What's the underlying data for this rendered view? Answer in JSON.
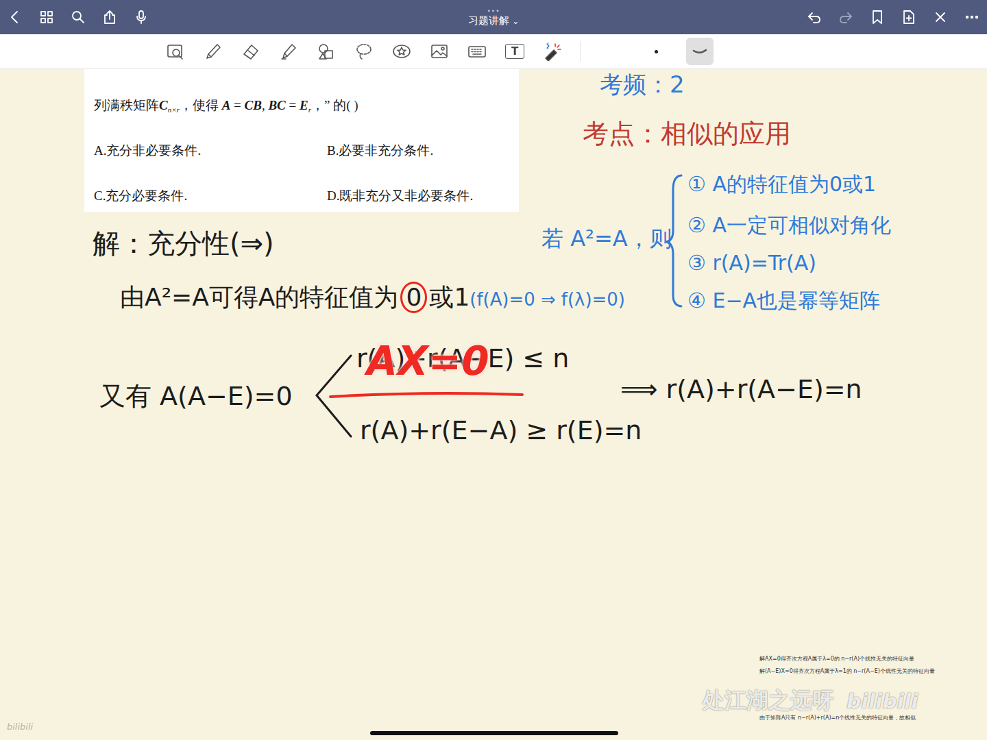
{
  "top_bar": {
    "handle": "•••",
    "title": "习题讲解",
    "title_caret": "⌄"
  },
  "toolbar": {
    "tools": [
      {
        "kind": "zoom",
        "glyph": "",
        "selected": false
      },
      {
        "kind": "pen",
        "glyph": "",
        "selected": false
      },
      {
        "kind": "eraser",
        "glyph": "",
        "selected": false
      },
      {
        "kind": "highlighter",
        "glyph": "",
        "selected": false
      },
      {
        "kind": "shapes",
        "glyph": "",
        "selected": false
      },
      {
        "kind": "lasso",
        "glyph": "",
        "selected": false
      },
      {
        "kind": "sticker",
        "glyph": "",
        "selected": false
      },
      {
        "kind": "image",
        "glyph": "",
        "selected": false
      },
      {
        "kind": "keyboard",
        "glyph": "",
        "selected": false
      },
      {
        "kind": "text",
        "glyph": "T",
        "selected": false
      },
      {
        "kind": "laser",
        "glyph": "",
        "selected": false
      }
    ],
    "pen_options": [
      {
        "kind": "dot",
        "selected": false
      },
      {
        "kind": "curve",
        "selected": true
      }
    ]
  },
  "problem": {
    "stem": [
      {
        "kind": "text",
        "text": "列满秩矩阵"
      },
      {
        "kind": "math",
        "text": "C"
      },
      {
        "kind": "sub",
        "text": "n×r"
      },
      {
        "kind": "text",
        "text": "，使得 "
      },
      {
        "kind": "math",
        "text": "A"
      },
      {
        "kind": "text",
        "text": " = "
      },
      {
        "kind": "math",
        "text": "CB"
      },
      {
        "kind": "text",
        "text": ", "
      },
      {
        "kind": "math",
        "text": "BC"
      },
      {
        "kind": "text",
        "text": " = "
      },
      {
        "kind": "math",
        "text": "E"
      },
      {
        "kind": "sub",
        "text": "r"
      },
      {
        "kind": "text",
        "text": "，” 的(      )"
      }
    ],
    "options": [
      "A.充分非必要条件.",
      "B.必要非充分条件.",
      "C.充分必要条件.",
      "D.既非充分又非必要条件."
    ]
  },
  "notes": [
    {
      "parts": [
        {
          "text": "考频：2",
          "color": "#2f7bd8",
          "circled": false
        }
      ]
    },
    {
      "parts": [
        {
          "text": "考点：相似的应用",
          "color": "#c23a2e",
          "circled": false
        }
      ]
    },
    {
      "parts": [
        {
          "text": "若 A²=A，则",
          "color": "#2f7bd8",
          "circled": false
        }
      ]
    },
    {
      "parts": [
        {
          "text": "① A的特征值为0或1",
          "color": "#2f7bd8",
          "circled": false
        }
      ]
    },
    {
      "parts": [
        {
          "text": "② A一定可相似对角化",
          "color": "#2f7bd8",
          "circled": false
        }
      ]
    },
    {
      "parts": [
        {
          "text": "③ r(A)=Tr(A)",
          "color": "#2f7bd8",
          "circled": false
        }
      ]
    },
    {
      "parts": [
        {
          "text": "④ E−A也是幂等矩阵",
          "color": "#2f7bd8",
          "circled": false
        }
      ]
    },
    {
      "parts": [
        {
          "text": "解：充分性(⇒)",
          "color": "#1c1c1c",
          "circled": false
        }
      ]
    },
    {
      "parts": [
        {
          "text": "由A²=A可得A的特征值为",
          "color": "#1c1c1c",
          "circled": false
        },
        {
          "text": "0",
          "color": "#1c1c1c",
          "circled": true
        },
        {
          "text": "或1",
          "color": "#1c1c1c",
          "circled": false
        },
        {
          "text": "(f(A)=0 ⇒ f(λ)=0)",
          "color": "#2f7bd8",
          "circled": false
        }
      ]
    },
    {
      "parts": [
        {
          "text": "又有 A(A−E)=0",
          "color": "#1c1c1c",
          "circled": false
        }
      ]
    },
    {
      "parts": [
        {
          "text": "r(A)+r(A−E) ≤ n",
          "color": "#1c1c1c",
          "circled": false
        }
      ]
    },
    {
      "parts": [
        {
          "text": "r(A)+r(E−A) ≥ r(E)=n",
          "color": "#1c1c1c",
          "circled": false
        }
      ]
    },
    {
      "parts": [
        {
          "text": "⟹ r(A)+r(A−E)=n",
          "color": "#1c1c1c",
          "circled": false
        }
      ]
    },
    {
      "parts": [
        {
          "text": "AX=0",
          "color": "#ee2a22",
          "circled": false
        }
      ]
    }
  ],
  "tiny_notes": [
    "解AX=0得齐次方程A属于λ=0的 n−r(A)个线性无关的特征向量",
    "解(A−E)X=0得齐次方程A属于λ=1的 n−r(A−E)个线性无关的特征向量",
    "由于矩阵A只有 n−r(A)+r(A)=n个线性无关的特征向量，故相似"
  ],
  "watermark": {
    "channel": "处江湖之远呀",
    "logo": "bilibili",
    "corner_logo": "bilibili"
  }
}
